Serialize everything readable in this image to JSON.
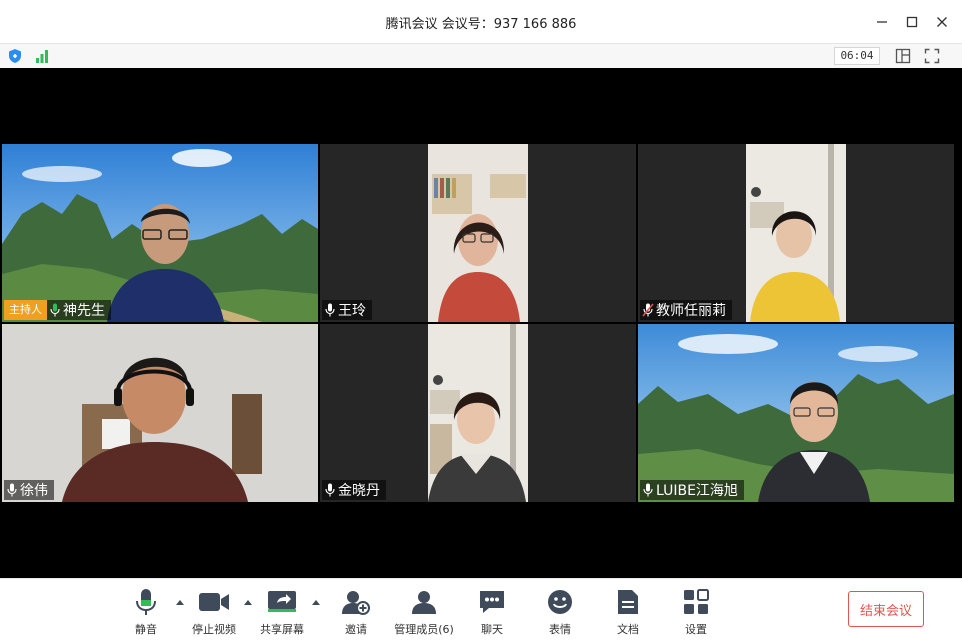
{
  "window": {
    "title": "腾讯会议 会议号：937 166 886"
  },
  "status": {
    "timer": "06:04"
  },
  "participants": [
    {
      "name": "神先生",
      "host_badge": "主持人",
      "muted": false
    },
    {
      "name": "王玲",
      "muted": false
    },
    {
      "name": "教师任丽莉",
      "muted": true
    },
    {
      "name": "徐伟",
      "muted": false
    },
    {
      "name": "金晓丹",
      "muted": false
    },
    {
      "name": "LUIBE江海旭",
      "muted": false
    }
  ],
  "toolbar": {
    "mute": "静音",
    "stop_video": "停止视频",
    "share_screen": "共享屏幕",
    "invite": "邀请",
    "manage_members": "管理成员(6)",
    "chat": "聊天",
    "reactions": "表情",
    "documents": "文档",
    "settings": "设置",
    "end_meeting": "结束会议"
  },
  "colors": {
    "accent": "#2d8cf0",
    "mic_active": "#2ebd59",
    "mic_muted": "#e2554f",
    "host_badge": "#f0a020",
    "end_button": "#e2554f"
  }
}
